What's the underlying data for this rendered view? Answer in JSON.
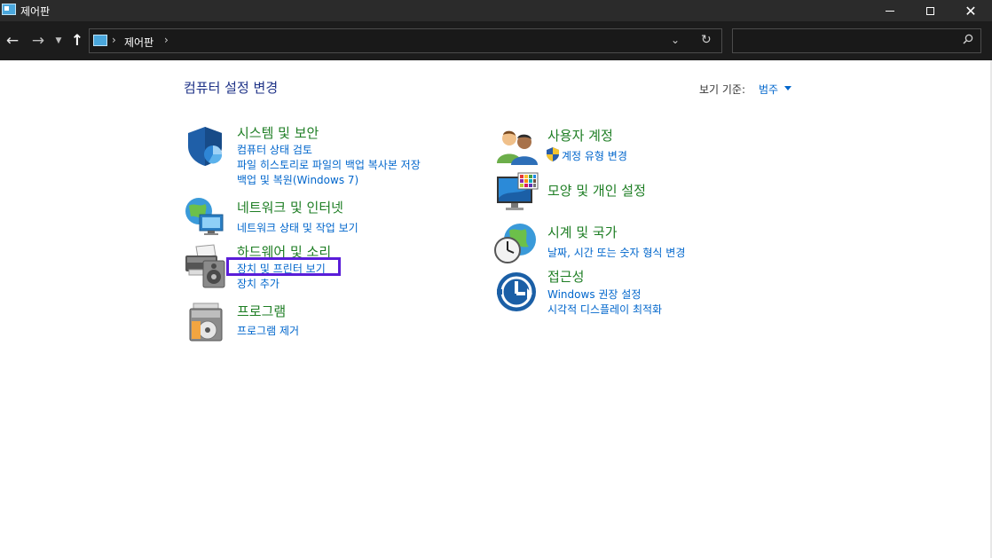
{
  "window": {
    "title": "제어판"
  },
  "address": {
    "crumb": "제어판",
    "search_placeholder": ""
  },
  "header": {
    "title": "컴퓨터 설정 변경",
    "view_by_label": "보기 기준:",
    "view_by_value": "범주"
  },
  "left_categories": [
    {
      "title": "시스템 및 보안",
      "icon": "shield-icon",
      "links": [
        "컴퓨터 상태 검토",
        "파일 히스토리로 파일의 백업 복사본 저장",
        "백업 및 복원(Windows 7)"
      ]
    },
    {
      "title": "네트워크 및 인터넷",
      "icon": "network-globe-icon",
      "links": [
        "네트워크 상태 및 작업 보기"
      ]
    },
    {
      "title": "하드웨어 및 소리",
      "icon": "printer-speaker-icon",
      "links": [
        "장치 및 프린터 보기",
        "장치 추가"
      ]
    },
    {
      "title": "프로그램",
      "icon": "programs-disc-icon",
      "links": [
        "프로그램 제거"
      ]
    }
  ],
  "right_categories": [
    {
      "title": "사용자 계정",
      "icon": "users-icon",
      "links": [
        "계정 유형 변경"
      ]
    },
    {
      "title": "모양 및 개인 설정",
      "icon": "monitor-palette-icon",
      "links": []
    },
    {
      "title": "시계 및 국가",
      "icon": "clock-globe-icon",
      "links": [
        "날짜, 시간 또는 숫자 형식 변경"
      ]
    },
    {
      "title": "접근성",
      "icon": "accessibility-icon",
      "links": [
        "Windows 권장 설정",
        "시각적 디스플레이 최적화"
      ]
    }
  ],
  "colors": {
    "link": "#0066cc",
    "category": "#1e7e24",
    "title": "#1e3287",
    "highlight": "#5a1dd8"
  }
}
